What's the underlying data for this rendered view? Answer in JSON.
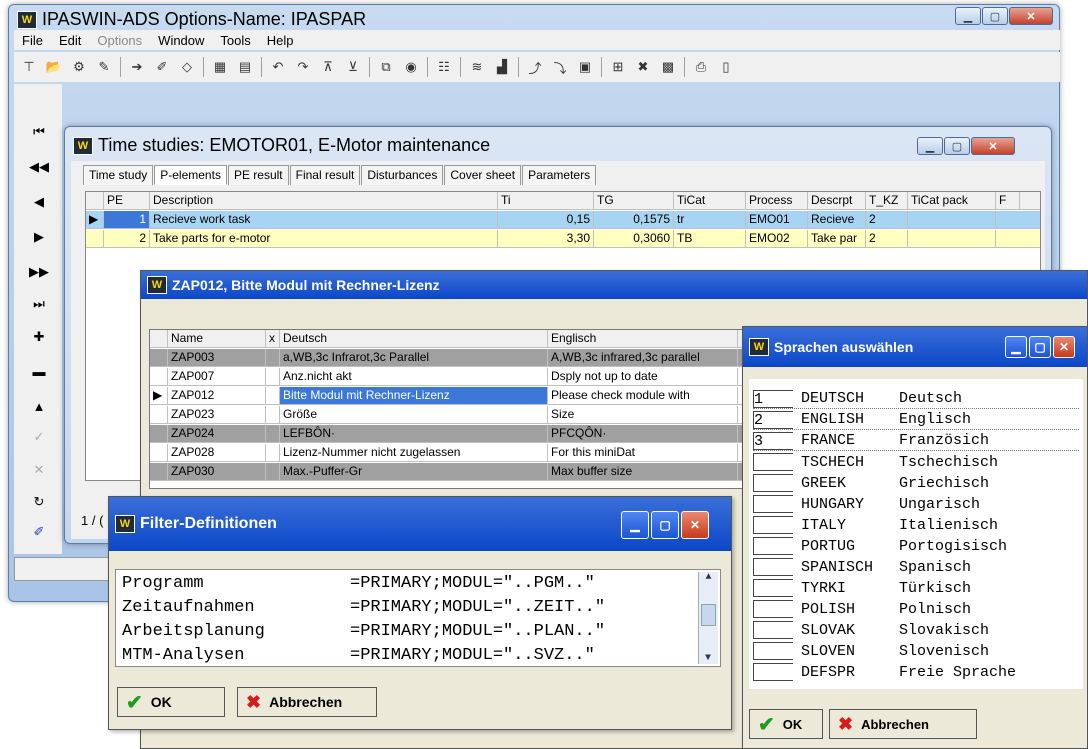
{
  "main": {
    "title": "IPASWIN-ADS   Options-Name: IPASPAR",
    "menu": [
      "File",
      "Edit",
      "Options",
      "Window",
      "Tools",
      "Help"
    ],
    "disabled_menu": "Options"
  },
  "time_studies": {
    "title": "Time studies: EMOTOR01, E-Motor maintenance",
    "tabs": [
      "Time study",
      "P-elements",
      "PE result",
      "Final result",
      "Disturbances",
      "Cover sheet",
      "Parameters"
    ],
    "selected_tab": "P-elements",
    "columns": [
      "PE",
      "Description",
      "Ti",
      "TG",
      "TiCat",
      "Process",
      "Descrpt",
      "T_KZ",
      "TiCat pack",
      "F"
    ],
    "rows": [
      {
        "pe": "1",
        "desc": "Recieve work task",
        "ti": "0,15",
        "tg": "0,1575",
        "ticat": "tr",
        "process": "EMO01",
        "descrpt": "Recieve",
        "tkz": "2"
      },
      {
        "pe": "2",
        "desc": "Take parts for e-motor",
        "ti": "3,30",
        "tg": "0,3060",
        "ticat": "TB",
        "process": "EMO02",
        "descrpt": "Take par",
        "tkz": "2"
      }
    ],
    "page_fragment": "1 / ("
  },
  "zap_window": {
    "title": "ZAP012, Bitte Modul mit Rechner-Lizenz",
    "columns": [
      "Name",
      "x",
      "Deutsch",
      "Englisch"
    ],
    "rows": [
      {
        "name": "ZAP003",
        "de": "a,WB,3c Infrarot,3c Parallel",
        "en": "A,WB,3c infrared,3c parallel"
      },
      {
        "name": "ZAP007",
        "de": "Anz.nicht akt",
        "en": "Dsply not up to date"
      },
      {
        "name": "ZAP012",
        "de": "Bitte Modul mit Rechner-Lizenz",
        "en": "Please check module with"
      },
      {
        "name": "ZAP023",
        "de": "Größe",
        "en": "Size"
      },
      {
        "name": "ZAP024",
        "de": "LEFBÔN·",
        "en": "PFCQÔN·"
      },
      {
        "name": "ZAP028",
        "de": "Lizenz-Nummer nicht zugelassen",
        "en": "For this miniDat"
      },
      {
        "name": "ZAP030",
        "de": "Max.-Puffer-Gr",
        "en": "Max buffer size"
      }
    ]
  },
  "filter_window": {
    "title": "Filter-Definitionen",
    "rows": [
      {
        "name": "Programm",
        "value": "=PRIMARY;MODUL=\"..PGM..\""
      },
      {
        "name": "Zeitaufnahmen",
        "value": "=PRIMARY;MODUL=\"..ZEIT..\""
      },
      {
        "name": "Arbeitsplanung",
        "value": "=PRIMARY;MODUL=\"..PLAN..\""
      },
      {
        "name": "MTM-Analysen",
        "value": "=PRIMARY;MODUL=\"..SVZ..\""
      }
    ],
    "ok": "OK",
    "cancel": "Abbrechen"
  },
  "lang_window": {
    "title": "Sprachen auswählen",
    "rows": [
      {
        "n": "1",
        "code": "DEUTSCH",
        "name": "Deutsch"
      },
      {
        "n": "2",
        "code": "ENGLISH",
        "name": "Englisch"
      },
      {
        "n": "3",
        "code": "FRANCE",
        "name": "Französich"
      },
      {
        "n": "",
        "code": "TSCHECH",
        "name": "Tschechisch"
      },
      {
        "n": "",
        "code": "GREEK",
        "name": "Griechisch"
      },
      {
        "n": "",
        "code": "HUNGARY",
        "name": "Ungarisch"
      },
      {
        "n": "",
        "code": "ITALY",
        "name": "Italienisch"
      },
      {
        "n": "",
        "code": "PORTUG",
        "name": "Portogisisch"
      },
      {
        "n": "",
        "code": "SPANISCH",
        "name": "Spanisch"
      },
      {
        "n": "",
        "code": "TYRKI",
        "name": "Türkisch"
      },
      {
        "n": "",
        "code": "POLISH",
        "name": "Polnisch"
      },
      {
        "n": "",
        "code": "SLOVAK",
        "name": "Slovakisch"
      },
      {
        "n": "",
        "code": "SLOVEN",
        "name": "Slovenisch"
      },
      {
        "n": "",
        "code": "DEFSPR",
        "name": "Freie Sprache"
      }
    ],
    "ok": "OK",
    "cancel": "Abbrechen"
  },
  "colors": {
    "selected_row": "#3c78d8",
    "pe_yellow": "#ffffc0",
    "gray_row": "#a0a0a0",
    "title_blue": "#0b47c9"
  }
}
